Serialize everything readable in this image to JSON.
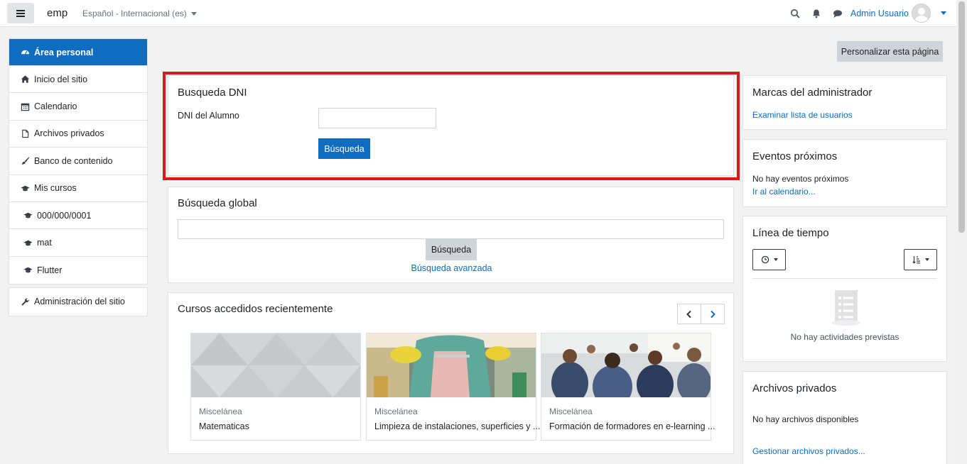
{
  "navbar": {
    "site_name": "emp",
    "language": "Español - Internacional (es)",
    "user_name": "Admin Usuario"
  },
  "sidebar": {
    "items": [
      {
        "label": "Área personal",
        "icon": "dashboard-icon"
      },
      {
        "label": "Inicio del sitio",
        "icon": "home-icon"
      },
      {
        "label": "Calendario",
        "icon": "calendar-icon"
      },
      {
        "label": "Archivos privados",
        "icon": "file-icon"
      },
      {
        "label": "Banco de contenido",
        "icon": "brush-icon"
      },
      {
        "label": "Mis cursos",
        "icon": "graduation-cap-icon"
      },
      {
        "label": "000/000/0001",
        "icon": "graduation-cap-icon"
      },
      {
        "label": "mat",
        "icon": "graduation-cap-icon"
      },
      {
        "label": "Flutter",
        "icon": "graduation-cap-icon"
      }
    ],
    "admin": {
      "label": "Administración del sitio",
      "icon": "wrench-icon"
    }
  },
  "main": {
    "customize_label": "Personalizar esta página",
    "dni": {
      "title": "Busqueda DNI",
      "field_label": "DNI del Alumno",
      "input_value": "",
      "button_label": "Búsqueda"
    },
    "global_search": {
      "title": "Búsqueda global",
      "input_value": "",
      "button_label": "Búsqueda",
      "advanced_link": "Búsqueda avanzada"
    },
    "recent": {
      "title": "Cursos accedidos recientemente",
      "courses": [
        {
          "category": "Miscelánea",
          "name": "Matematicas"
        },
        {
          "category": "Miscelánea",
          "name": "Limpieza de instalaciones, superficies y ..."
        },
        {
          "category": "Miscelánea",
          "name": "Formación de formadores en e-learning ..."
        }
      ]
    }
  },
  "blocks": {
    "admin_marks": {
      "title": "Marcas del administrador",
      "link": "Examinar lista de usuarios"
    },
    "upcoming": {
      "title": "Eventos próximos",
      "text": "No hay eventos próximos",
      "link": "Ir al calendario..."
    },
    "timeline": {
      "title": "Línea de tiempo",
      "empty_text": "No hay actividades previstas"
    },
    "private_files": {
      "title": "Archivos privados",
      "text": "No hay archivos disponibles",
      "link": "Gestionar archivos privados..."
    }
  },
  "colors": {
    "primary": "#0f6cbf",
    "highlight_frame": "#e2151b"
  }
}
